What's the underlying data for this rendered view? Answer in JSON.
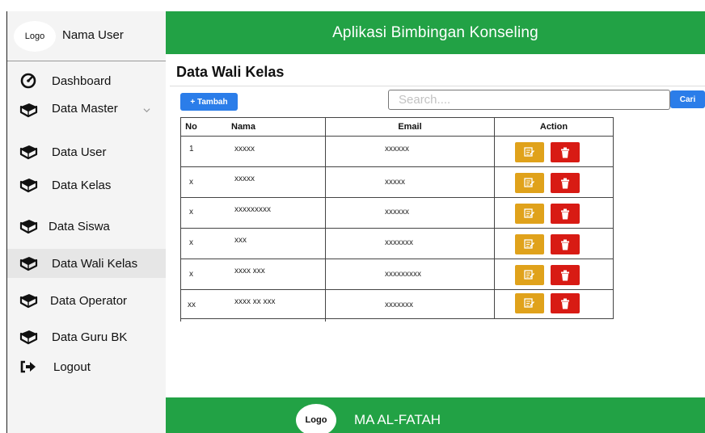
{
  "sidebar": {
    "logo": "Logo",
    "user_name": "Nama User",
    "items": [
      {
        "label": "Dashboard",
        "icon": "gauge-icon"
      },
      {
        "label": "Data Master",
        "icon": "book-icon"
      },
      {
        "label": "Data User",
        "icon": "book-icon"
      },
      {
        "label": "Data Kelas",
        "icon": "book-icon"
      },
      {
        "label": "Data Siswa",
        "icon": "book-icon"
      },
      {
        "label": "Data Wali Kelas",
        "icon": "book-icon"
      },
      {
        "label": "Data Operator",
        "icon": "book-icon"
      },
      {
        "label": "Data Guru BK",
        "icon": "book-icon"
      },
      {
        "label": "Logout",
        "icon": "logout-icon"
      }
    ],
    "active_item": "Data Wali Kelas"
  },
  "header": {
    "title": "Aplikasi Bimbingan Konseling"
  },
  "main": {
    "page_title": "Data Wali Kelas",
    "add_button": "+ Tambah",
    "search_placeholder": "Search....",
    "search_button": "Cari",
    "table": {
      "columns": [
        "No",
        "Nama",
        "Email",
        "Action"
      ],
      "rows": [
        {
          "no": "1",
          "nama": "xxxxx",
          "email": "xxxxxx"
        },
        {
          "no": "x",
          "nama": "xxxxx",
          "email": "xxxxx"
        },
        {
          "no": "x",
          "nama": "xxxxxxxxx",
          "email": "xxxxxx"
        },
        {
          "no": "x",
          "nama": "xxx",
          "email": "xxxxxxx"
        },
        {
          "no": "x",
          "nama": "xxxx xxx",
          "email": "xxxxxxxxx"
        },
        {
          "no": "xx",
          "nama": "xxxx xx xxx",
          "email": "xxxxxxx"
        }
      ]
    }
  },
  "footer": {
    "logo": "Logo",
    "name": "MA AL-FATAH"
  },
  "colors": {
    "green": "#22a245",
    "blue": "#2b7de9",
    "edit": "#e0a21b",
    "delete": "#d81b14"
  }
}
